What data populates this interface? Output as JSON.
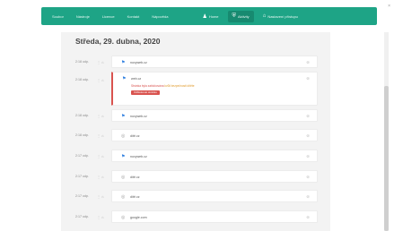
{
  "nav": {
    "links": [
      "Soubor",
      "Nástroje",
      "Licence",
      "Kontakt",
      "Nápověda"
    ],
    "home_label": "Home",
    "activity_label": "Aktivity",
    "account_label": "Nastavení přístupu",
    "close_glyph": "×"
  },
  "date_heading": "Středa, 29. dubna, 2020",
  "timeline": [
    {
      "time": "2:18 odp.",
      "tools": "⋮ ⌂",
      "icon": "flag-icon",
      "label": "novyweb.cz",
      "alert": false
    },
    {
      "time": "2:18 odp.",
      "tools": "⋮ ⌂",
      "icon": "flag-icon",
      "label": "web.cz",
      "alert": true,
      "warning_text": "Stránka byla zablokována",
      "warning_suffix": "kvůli bezpečnosti dítěte",
      "warning_button": "Odblokovat stránku"
    },
    {
      "time": "2:18 odp.",
      "tools": "⋮ ⌂",
      "icon": "flag-icon",
      "label": "novyweb.cz",
      "alert": false
    },
    {
      "time": "2:18 odp.",
      "tools": "⋮ ⌂",
      "icon": "globe-icon",
      "label": "dítě.cz",
      "alert": false
    },
    {
      "time": "2:17 odp.",
      "tools": "⋮ ⌂",
      "icon": "flag-icon",
      "label": "novyweb.cz",
      "alert": false
    },
    {
      "time": "2:17 odp.",
      "tools": "⋮ ⌂",
      "icon": "globe-icon",
      "label": "dítě.cz",
      "alert": false
    },
    {
      "time": "2:17 odp.",
      "tools": "⋮ ⌂",
      "icon": "globe-icon",
      "label": "dítě.cz",
      "alert": false
    },
    {
      "time": "2:17 odp.",
      "tools": "⋮ ⌂",
      "icon": "globe-icon",
      "label": "google.com",
      "alert": false
    }
  ],
  "colors": {
    "accent": "#1ea486",
    "alert": "#d9534f",
    "flag": "#2f7fe0"
  }
}
